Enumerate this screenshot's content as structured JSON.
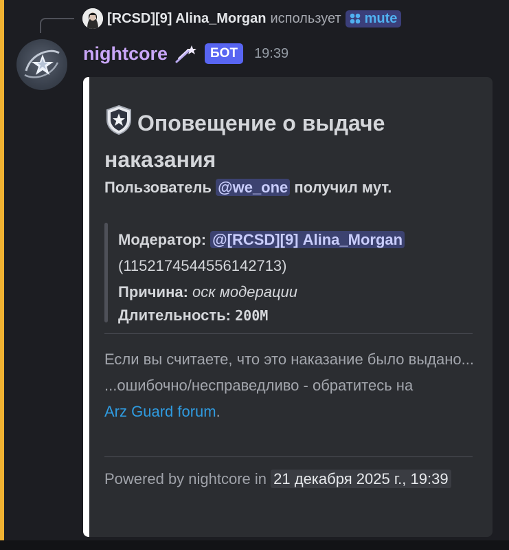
{
  "reply": {
    "username": "[RCSD][9] Alina_Morgan",
    "uses_text": "использует",
    "command": "mute"
  },
  "message": {
    "author": "nightcore",
    "bot_badge": "БОТ",
    "time": "19:39"
  },
  "embed": {
    "title": "Оповещение о выдаче наказания",
    "description": {
      "prefix": "Пользователь",
      "mention": "@we_one",
      "suffix": "получил мут."
    },
    "moderator_label": "Модератор:",
    "moderator_mention": "@[RCSD][9] Alina_Morgan",
    "moderator_id": "(1152174544556142713)",
    "reason_label": "Причина:",
    "reason_value": "оск модерации",
    "duration_label": "Длительность:",
    "duration_value": "200M",
    "appeal_line1": "Если вы считаете, что это наказание было выдано...",
    "appeal_line2_prefix": "...ошибочно/несправедливо - обратитесь на",
    "appeal_link": "Arz Guard forum",
    "appeal_line2_suffix": ".",
    "footer_text": "Powered by nightcore in",
    "footer_timestamp": "21 декабря 2025 г., 19:39"
  },
  "colors": {
    "mention_bar": "#f0b232",
    "author": "#c9a6f8",
    "bot_badge": "#5865f2",
    "link": "#2f9be0",
    "embed_accent": "#ffffff"
  },
  "icons": {
    "reply_avatar": "user-avatar",
    "command": "command-icon",
    "author_emoji": "comet-icon",
    "title_emoji": "shield-star-icon",
    "bot_avatar": "star-avatar"
  }
}
